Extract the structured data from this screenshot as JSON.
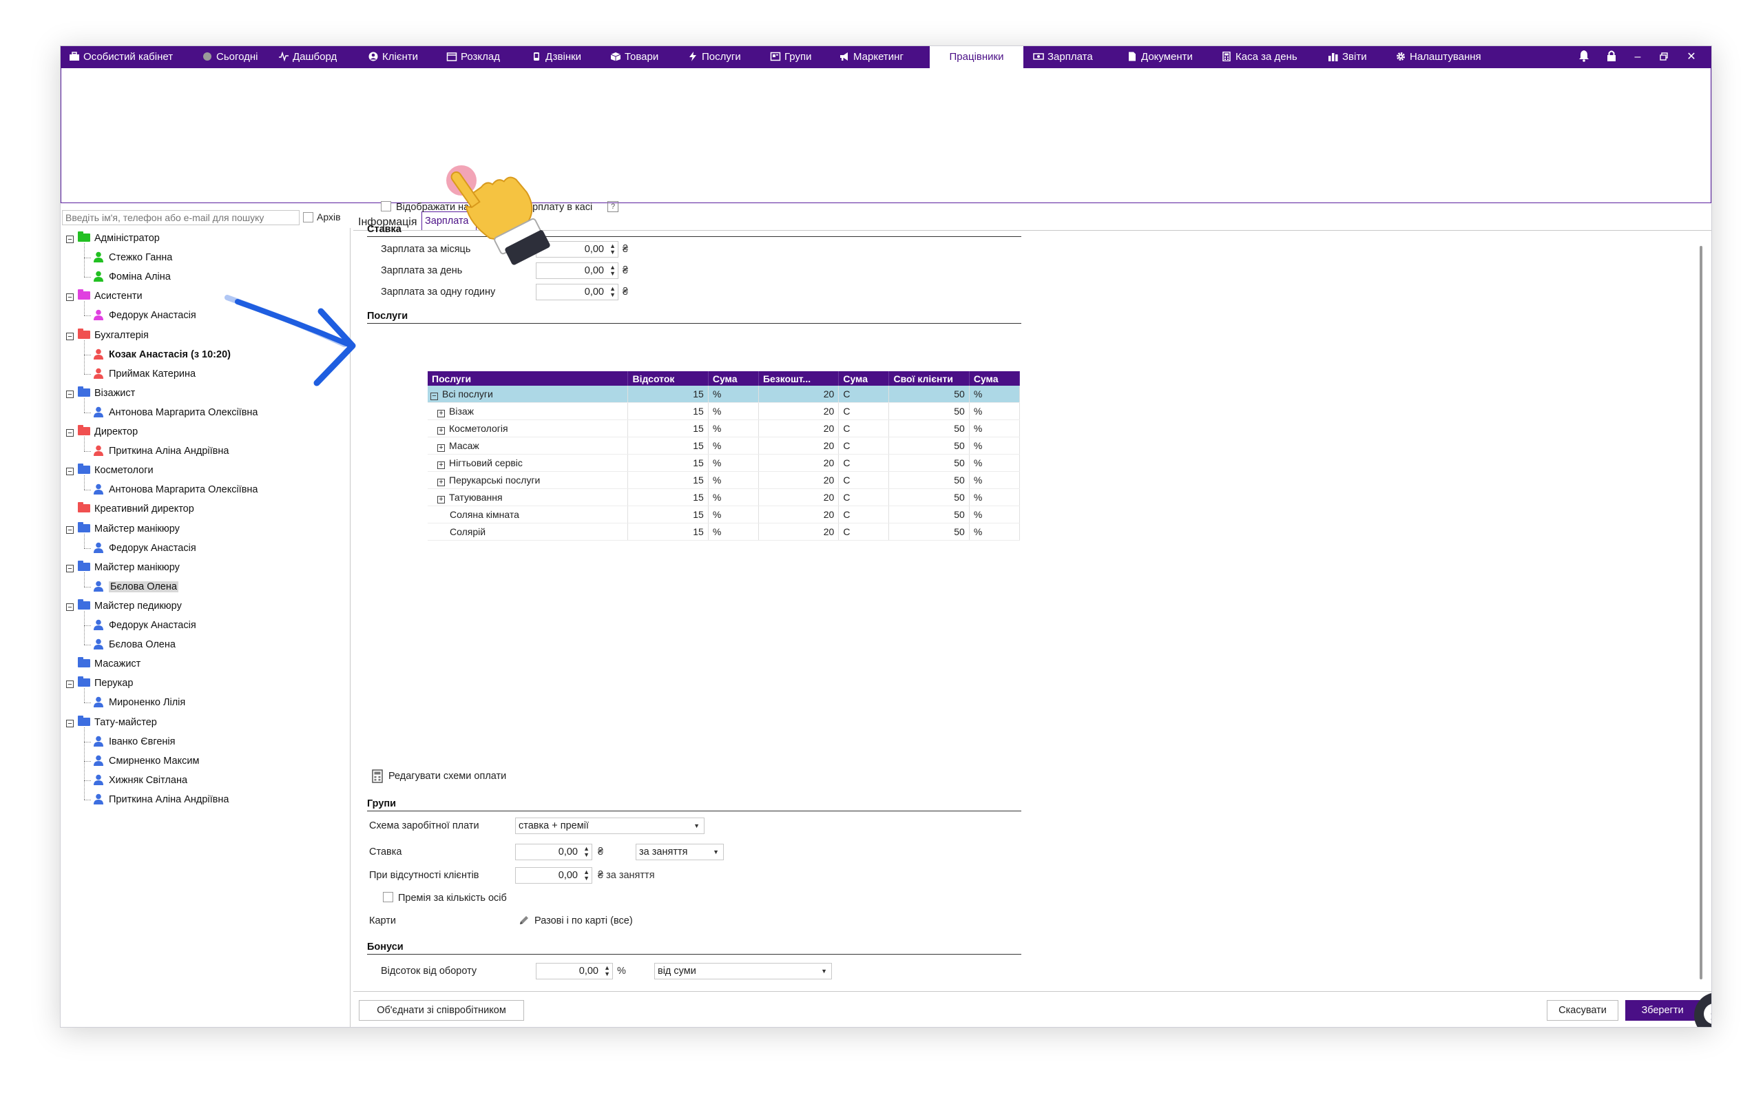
{
  "nav": {
    "items": [
      {
        "label": "Особистий кабінет",
        "icon": "briefcase-icon"
      },
      {
        "label": "Сьогодні",
        "icon": "today-circle-icon"
      },
      {
        "label": "Дашборд",
        "icon": "pulse-icon"
      },
      {
        "label": "Клієнти",
        "icon": "user-circle-icon"
      },
      {
        "label": "Розклад",
        "icon": "calendar-icon"
      },
      {
        "label": "Дзвінки",
        "icon": "phone-icon"
      },
      {
        "label": "Товари",
        "icon": "box-icon"
      },
      {
        "label": "Послуги",
        "icon": "bolt-icon"
      },
      {
        "label": "Групи",
        "icon": "group-icon"
      },
      {
        "label": "Маркетинг",
        "icon": "megaphone-icon"
      },
      {
        "label": "Працівники",
        "icon": ""
      },
      {
        "label": "Зарплата",
        "icon": "money-icon"
      },
      {
        "label": "Документи",
        "icon": "document-icon"
      },
      {
        "label": "Каса за день",
        "icon": "calculator-icon"
      },
      {
        "label": "Звіти",
        "icon": "bar-chart-icon"
      },
      {
        "label": "Налаштування",
        "icon": "gear-icon"
      }
    ],
    "active": "Працівники",
    "window_controls": [
      "bell-icon",
      "lock-icon",
      "minimize-icon",
      "restore-icon",
      "close-icon"
    ]
  },
  "search": {
    "placeholder": "Введіть ім'я, телефон або e-mail для пошуку",
    "archive_label": "Архів"
  },
  "tree": [
    {
      "type": "group",
      "label": "Адміністратор",
      "color": "#22c022",
      "expanded": true
    },
    {
      "type": "person",
      "label": "Стежко Ганна",
      "color": "#22c022"
    },
    {
      "type": "person",
      "label": "Фоміна Аліна",
      "color": "#22c022"
    },
    {
      "type": "group",
      "label": "Асистенти",
      "color": "#e040e0",
      "expanded": true
    },
    {
      "type": "person",
      "label": "Федорук Анастасія",
      "color": "#e040e0"
    },
    {
      "type": "group",
      "label": "Бухгалтерія",
      "color": "#f05050",
      "expanded": true
    },
    {
      "type": "person",
      "label": "Козак Анастасія (з 10:20)",
      "color": "#f05050",
      "bold": true
    },
    {
      "type": "person",
      "label": "Приймак Катерина",
      "color": "#f05050"
    },
    {
      "type": "group",
      "label": "Візажист",
      "color": "#3d6ee0",
      "expanded": true
    },
    {
      "type": "person",
      "label": "Антонова Маргарита Олексіївна",
      "color": "#3d6ee0"
    },
    {
      "type": "group",
      "label": "Директор",
      "color": "#f05050",
      "expanded": true
    },
    {
      "type": "person",
      "label": "Приткина Аліна Андріївна",
      "color": "#f05050"
    },
    {
      "type": "group",
      "label": "Косметологи",
      "color": "#3d6ee0",
      "expanded": true
    },
    {
      "type": "person",
      "label": "Антонова Маргарита Олексіївна",
      "color": "#3d6ee0"
    },
    {
      "type": "group",
      "label": "Креативний директор",
      "color": "#f05050",
      "expanded": false,
      "leaf": true
    },
    {
      "type": "group",
      "label": "Майстер манікюру",
      "color": "#3d6ee0",
      "expanded": true
    },
    {
      "type": "person",
      "label": "Федорук Анастасія",
      "color": "#3d6ee0"
    },
    {
      "type": "group",
      "label": "Майстер манікюру",
      "color": "#3d6ee0",
      "expanded": true
    },
    {
      "type": "person",
      "label": "Бєлова Олена",
      "color": "#3d6ee0",
      "selected": true
    },
    {
      "type": "group",
      "label": "Майстер педикюру",
      "color": "#3d6ee0",
      "expanded": true
    },
    {
      "type": "person",
      "label": "Федорук Анастасія",
      "color": "#3d6ee0"
    },
    {
      "type": "person",
      "label": "Бєлова Олена",
      "color": "#3d6ee0"
    },
    {
      "type": "group",
      "label": "Масажист",
      "color": "#3d6ee0",
      "expanded": false,
      "leaf": true
    },
    {
      "type": "group",
      "label": "Перукар",
      "color": "#3d6ee0",
      "expanded": true
    },
    {
      "type": "person",
      "label": "Мироненко Лілія",
      "color": "#3d6ee0"
    },
    {
      "type": "group",
      "label": "Тату-майстер",
      "color": "#3d6ee0",
      "expanded": true
    },
    {
      "type": "person",
      "label": "Іванко Євгенія",
      "color": "#3d6ee0"
    },
    {
      "type": "person",
      "label": "Смирненко Максим",
      "color": "#3d6ee0"
    },
    {
      "type": "person",
      "label": "Хижняк Світлана",
      "color": "#3d6ee0"
    },
    {
      "type": "person",
      "label": "Приткина Аліна Андріївна",
      "color": "#3d6ee0"
    }
  ],
  "tabs": {
    "info": "Інформація",
    "salary": "Зарплата"
  },
  "salary": {
    "show_in_cash_label_a": "Відображати нар",
    "show_in_cash_label_b": "арплату в касі",
    "help": "?",
    "rate": {
      "title": "Ставка",
      "month_label": "Зарплата за місяць",
      "month_value": "0,00",
      "day_label": "Зарплата за день",
      "day_value": "0,00",
      "hour_label": "Зарплата за одну годину",
      "hour_value": "0,00",
      "currency": "₴"
    },
    "services": {
      "title": "Послуги",
      "columns": [
        "Послуги",
        "Відсоток",
        "Сума",
        "Безкошт...",
        "Сума",
        "Свої клієнти",
        "Сума"
      ],
      "rows": [
        {
          "name": "Всі послуги",
          "pct": "15",
          "u1": "%",
          "free": "20",
          "u2": "C",
          "own": "50",
          "u3": "%",
          "toggle": "−",
          "highlight": true
        },
        {
          "name": "Візаж",
          "pct": "15",
          "u1": "%",
          "free": "20",
          "u2": "C",
          "own": "50",
          "u3": "%",
          "toggle": "+"
        },
        {
          "name": "Косметологія",
          "pct": "15",
          "u1": "%",
          "free": "20",
          "u2": "C",
          "own": "50",
          "u3": "%",
          "toggle": "+"
        },
        {
          "name": "Масаж",
          "pct": "15",
          "u1": "%",
          "free": "20",
          "u2": "C",
          "own": "50",
          "u3": "%",
          "toggle": "+"
        },
        {
          "name": "Нігтьовий сервіс",
          "pct": "15",
          "u1": "%",
          "free": "20",
          "u2": "C",
          "own": "50",
          "u3": "%",
          "toggle": "+"
        },
        {
          "name": "Перукарські послуги",
          "pct": "15",
          "u1": "%",
          "free": "20",
          "u2": "C",
          "own": "50",
          "u3": "%",
          "toggle": "+"
        },
        {
          "name": "Татуювання",
          "pct": "15",
          "u1": "%",
          "free": "20",
          "u2": "C",
          "own": "50",
          "u3": "%",
          "toggle": "+"
        },
        {
          "name": "Соляна кімната",
          "pct": "15",
          "u1": "%",
          "free": "20",
          "u2": "C",
          "own": "50",
          "u3": "%",
          "toggle": ""
        },
        {
          "name": "Солярій",
          "pct": "15",
          "u1": "%",
          "free": "20",
          "u2": "C",
          "own": "50",
          "u3": "%",
          "toggle": ""
        }
      ]
    },
    "edit_schemes_label": "Редагувати схеми оплати",
    "groups": {
      "title": "Групи",
      "scheme_label": "Схема заробітної плати",
      "scheme_value": "ставка + премії",
      "rate_label": "Ставка",
      "rate_value": "0,00",
      "rate_unit": "₴",
      "rate_per": "за заняття",
      "absence_label": "При відсутності клієнтів",
      "absence_value": "0,00",
      "absence_unit": "₴ за заняття",
      "bonus_persons_label": "Премія за кількість осіб",
      "cards_label": "Карти",
      "cards_value": "Разові і по карті (все)"
    },
    "bonuses": {
      "title": "Бонуси",
      "turnover_label": "Відсоток від обороту",
      "turnover_value": "0,00",
      "turnover_unit": "%",
      "turnover_base": "від суми"
    }
  },
  "buttons": {
    "merge": "Об'єднати зі співробітником",
    "cancel": "Скасувати",
    "save": "Зберегти"
  },
  "colors": {
    "brand": "#4a0f86",
    "highlight_row": "#add8e6",
    "annotation_arrow": "#1f5ee0"
  }
}
